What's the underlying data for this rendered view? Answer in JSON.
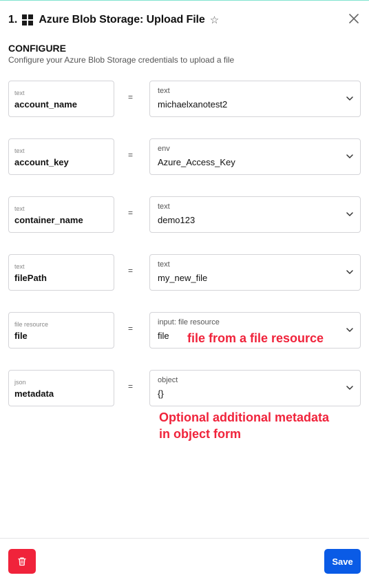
{
  "header": {
    "step_number": "1.",
    "title": "Azure Blob Storage: Upload File",
    "app_icon": "grid-squares-icon",
    "favorite_icon": "star-outline-icon",
    "close_icon": "close-icon"
  },
  "configure": {
    "title": "CONFIGURE",
    "subtitle": "Configure your Azure Blob Storage credentials to upload a file"
  },
  "inputs": [
    {
      "type": "text",
      "name": "account_name",
      "equals": "=",
      "value_type": "text",
      "value": "michaelxanotest2"
    },
    {
      "type": "text",
      "name": "account_key",
      "equals": "=",
      "value_type": "env",
      "value": "Azure_Access_Key"
    },
    {
      "type": "text",
      "name": "container_name",
      "equals": "=",
      "value_type": "text",
      "value": "demo123"
    },
    {
      "type": "text",
      "name": "filePath",
      "equals": "=",
      "value_type": "text",
      "value": "my_new_file"
    },
    {
      "type": "file resource",
      "name": "file",
      "equals": "=",
      "value_type": "input: file resource",
      "value": "file"
    },
    {
      "type": "json",
      "name": "metadata",
      "equals": "=",
      "value_type": "object",
      "value": "{}"
    }
  ],
  "annotations": {
    "file_note": "file from a file resource",
    "metadata_note_line1": "Optional additional metadata",
    "metadata_note_line2": "in object form"
  },
  "footer": {
    "delete_icon": "trash-icon",
    "save_label": "Save"
  },
  "colors": {
    "accent_blue": "#0a5be6",
    "danger_red": "#f0233b",
    "annotation_red": "#f0233b",
    "top_border": "#7fe3cf"
  }
}
